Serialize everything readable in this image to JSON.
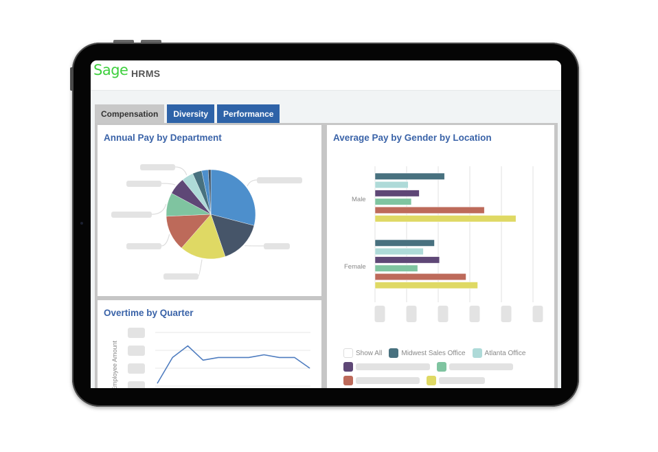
{
  "app": {
    "brand": "Sage",
    "title": "HRMS",
    "brand_color": "#3ecf3e"
  },
  "tabs": [
    {
      "label": "Compensation",
      "active": true
    },
    {
      "label": "Diversity",
      "active": false
    },
    {
      "label": "Performance",
      "active": false
    }
  ],
  "colors": {
    "tab_active": "#c8c8c8",
    "tab_inactive": "#2e63a8",
    "panel_title": "#3a63a8"
  },
  "chart_data": [
    {
      "id": "annual-pay",
      "type": "pie",
      "title": "Annual Pay by Department",
      "labels_hidden": true,
      "slices": [
        {
          "value": 30.5,
          "color": "#4d8fcc"
        },
        {
          "value": 16.5,
          "color": "#465569"
        },
        {
          "value": 17.5,
          "color": "#dfd964"
        },
        {
          "value": 13.5,
          "color": "#bd6a5a"
        },
        {
          "value": 9.0,
          "color": "#7fc4a0"
        },
        {
          "value": 6.5,
          "color": "#5e4776"
        },
        {
          "value": 4.5,
          "color": "#aedad8"
        },
        {
          "value": 3.5,
          "color": "#48717f"
        },
        {
          "value": 2.5,
          "color": "#4d8fcc"
        },
        {
          "value": 1.0,
          "color": "#3a4c5e"
        }
      ]
    },
    {
      "id": "avg-pay",
      "type": "bar",
      "orientation": "horizontal",
      "title": "Average Pay by Gender by Location",
      "categories": [
        "Male",
        "Female"
      ],
      "xlim": [
        0,
        5
      ],
      "tick_labels_hidden": true,
      "series": [
        {
          "name": "Midwest Sales Office",
          "color": "#48717f",
          "values": [
            2.2,
            1.88
          ]
        },
        {
          "name": "Atlanta Office",
          "color": "#aedad8",
          "values": [
            1.05,
            1.53
          ]
        },
        {
          "name": "",
          "color": "#5e4776",
          "values": [
            1.4,
            2.04
          ]
        },
        {
          "name": "",
          "color": "#7fc4a0",
          "values": [
            1.15,
            1.35
          ]
        },
        {
          "name": "",
          "color": "#bd6a5a",
          "values": [
            3.46,
            2.88
          ]
        },
        {
          "name": "",
          "color": "#dfd964",
          "values": [
            4.46,
            3.25
          ]
        }
      ],
      "legend": {
        "show_all_label": "Show All",
        "position": "bottom"
      }
    },
    {
      "id": "overtime",
      "type": "line",
      "title": "Overtime by Quarter",
      "ylabel": "Employee Amount",
      "ylim": [
        0,
        3
      ],
      "tick_labels_hidden": true,
      "color": "#4e7cbf",
      "values": [
        0.15,
        1.6,
        2.25,
        1.45,
        1.6,
        1.6,
        1.6,
        1.75,
        1.6,
        1.6,
        1.0
      ]
    }
  ]
}
